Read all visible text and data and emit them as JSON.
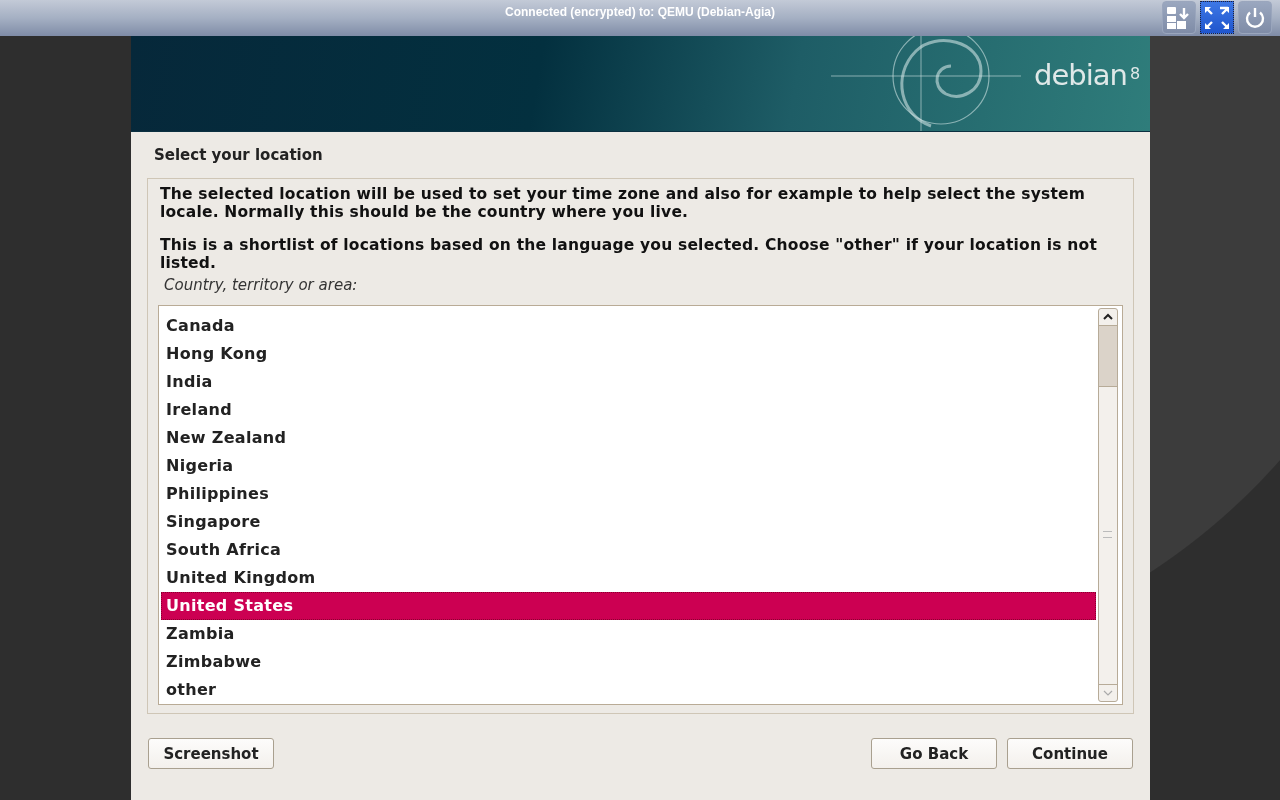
{
  "viewer": {
    "title": "Connected (encrypted) to: QEMU (Debian-Agia)"
  },
  "banner": {
    "logo": "debian",
    "version": "8"
  },
  "page": {
    "title": "Select your location",
    "paragraphs": [
      "The selected location will be used to set your time zone and also for example to help select the system locale. Normally this should be the country where you live.",
      "This is a shortlist of locations based on the language you selected. Choose \"other\" if your location is not listed."
    ],
    "list_label": "Country, territory or area:",
    "items": [
      {
        "label": "Canada",
        "selected": false
      },
      {
        "label": "Hong Kong",
        "selected": false
      },
      {
        "label": "India",
        "selected": false
      },
      {
        "label": "Ireland",
        "selected": false
      },
      {
        "label": "New Zealand",
        "selected": false
      },
      {
        "label": "Nigeria",
        "selected": false
      },
      {
        "label": "Philippines",
        "selected": false
      },
      {
        "label": "Singapore",
        "selected": false
      },
      {
        "label": "South Africa",
        "selected": false
      },
      {
        "label": "United Kingdom",
        "selected": false
      },
      {
        "label": "United States",
        "selected": true
      },
      {
        "label": "Zambia",
        "selected": false
      },
      {
        "label": "Zimbabwe",
        "selected": false
      },
      {
        "label": "other",
        "selected": false
      }
    ]
  },
  "buttons": {
    "left": [
      "Screenshot"
    ],
    "right": [
      "Go Back",
      "Continue"
    ]
  }
}
